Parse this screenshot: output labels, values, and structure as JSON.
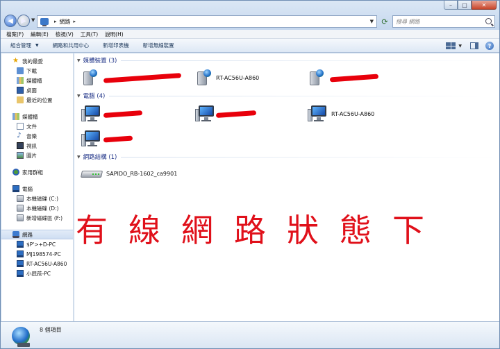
{
  "window": {
    "caption": {
      "minimize": "–",
      "maximize": "□",
      "close": "✕"
    }
  },
  "address": {
    "path": [
      "網路"
    ],
    "search_placeholder": "搜尋 網路"
  },
  "menubar": [
    "檔案(F)",
    "編輯(E)",
    "檢視(V)",
    "工具(T)",
    "說明(H)"
  ],
  "toolbar": {
    "organize": "組合管理",
    "network_center": "網路和共用中心",
    "add_printer": "新增印表機",
    "add_wireless": "新增無線裝置"
  },
  "navpane": {
    "favorites": {
      "label": "我的最愛",
      "items": [
        "下載",
        "媒體櫃",
        "桌面",
        "最近的位置"
      ]
    },
    "libraries": {
      "label": "媒體櫃",
      "items": [
        "文件",
        "音樂",
        "視訊",
        "圖片"
      ]
    },
    "homegroup": {
      "label": "家用群組"
    },
    "computer": {
      "label": "電腦",
      "items": [
        "本機磁碟 (C:)",
        "本機磁碟 (D:)",
        "新增磁碟區 (F:)"
      ]
    },
    "network": {
      "label": "網路",
      "items": [
        "$P'>+D-PC",
        "MJ198574-PC",
        "RT-AC56U-A860",
        "小屁孩-PC"
      ]
    }
  },
  "groups": {
    "media": {
      "label": "媒體裝置 (3)",
      "items": [
        "",
        "RT-AC56U-A860",
        ""
      ]
    },
    "computers": {
      "label": "電腦 (4)",
      "items": [
        "",
        "",
        "RT-AC56U-A860",
        ""
      ]
    },
    "infrastructure": {
      "label": "網路結構 (1)",
      "items": [
        "SAPIDO_RB-1602_ca9901"
      ]
    }
  },
  "overlay_text": "有線網路狀態下",
  "details": {
    "count": "8 個項目"
  },
  "colors": {
    "redaction": "#e8000b",
    "overlay": "#e0101a",
    "group_header": "#1e3287"
  }
}
